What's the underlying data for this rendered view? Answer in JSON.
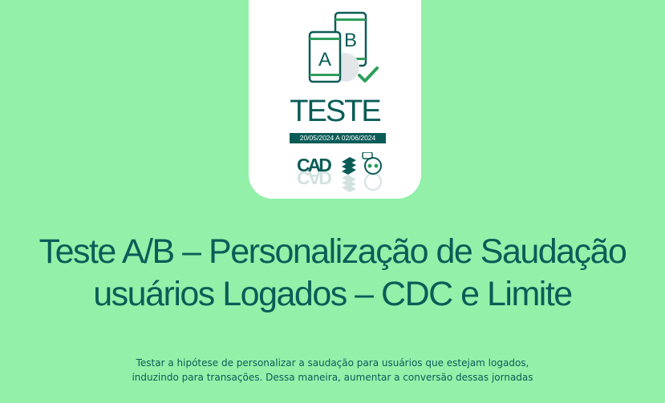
{
  "card": {
    "heading": "TESTE",
    "date_range": "20/05/2024 A 02/06/2024",
    "variant_a": "A",
    "variant_b": "B",
    "logos": [
      "cad-logo",
      "banco-do-brasil-logo",
      "robot-assistant-icon"
    ],
    "icon": "ab-test-phones-icon"
  },
  "title": {
    "line1": "Teste A/B – Personalização de Saudação",
    "line2": "usuários Logados – CDC e Limite"
  },
  "description": {
    "line1": "Testar a hipótese de personalizar a saudação para usuários que estejam logados,",
    "line2": "induzindo para transações. Dessa maneira, aumentar a conversão dessas jornadas"
  },
  "colors": {
    "background": "#93f0a9",
    "brand_dark": "#0b5c57",
    "accent_green": "#2e9e5b",
    "card": "#ffffff"
  }
}
